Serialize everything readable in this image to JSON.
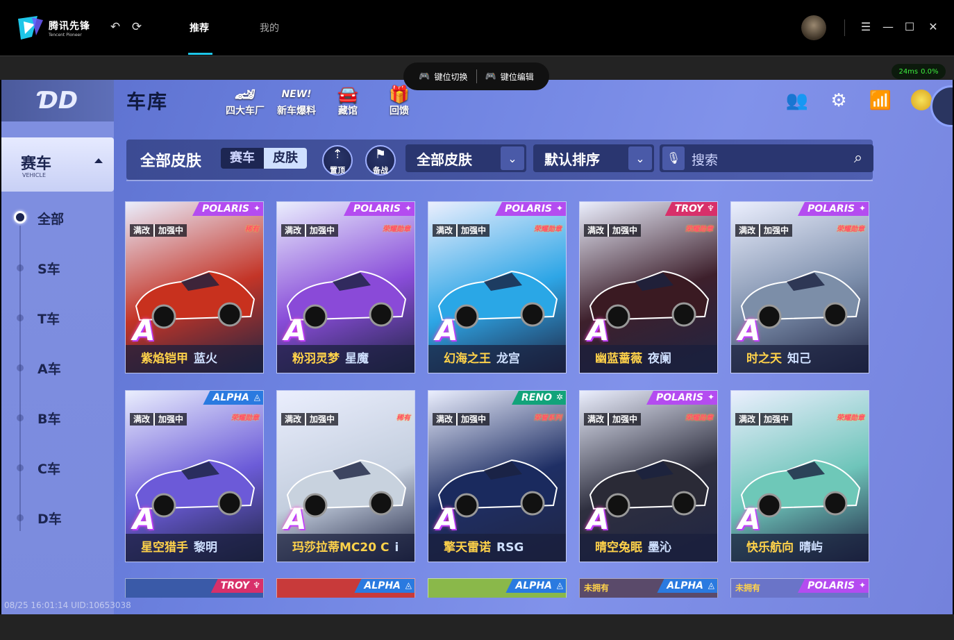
{
  "app": {
    "name": "腾讯先锋",
    "name_en": "Tencent Pioneer"
  },
  "nav": {
    "tabs": [
      {
        "label": "推荐"
      },
      {
        "label": "我的"
      }
    ]
  },
  "keybar": {
    "switch_label": "键位切换",
    "edit_label": "键位编辑"
  },
  "status": {
    "ping": "24ms",
    "loss": "0.0%"
  },
  "game": {
    "page_title": "车库",
    "header_tools": [
      {
        "label": "四大车厂",
        "icon": "car-factory-icon"
      },
      {
        "label": "新车爆料",
        "icon": "new-badge-icon"
      },
      {
        "label": "藏馆",
        "icon": "garage-icon"
      },
      {
        "label": "回馈",
        "icon": "gift-icon"
      }
    ],
    "sidebar": {
      "category": "赛车",
      "category_en": "VEHICLE",
      "items": [
        {
          "label": "全部",
          "active": true
        },
        {
          "label": "S车"
        },
        {
          "label": "T车"
        },
        {
          "label": "A车"
        },
        {
          "label": "B车"
        },
        {
          "label": "C车"
        },
        {
          "label": "D车"
        }
      ]
    },
    "filter": {
      "title": "全部皮肤",
      "segments": [
        {
          "label": "赛车"
        },
        {
          "label": "皮肤",
          "active": true
        }
      ],
      "pin_label": "置顶",
      "ready_label": "备战",
      "skin_dropdown": "全部皮肤",
      "sort_dropdown": "默认排序",
      "search_placeholder": "搜索"
    },
    "cards": [
      {
        "brand": "POLARIS",
        "maxed": "满改",
        "boost": "加强中",
        "badge": "稀有",
        "grade": "A",
        "name1": "紫焰铠甲",
        "name2": "蓝火",
        "color": "#c8311e"
      },
      {
        "brand": "POLARIS",
        "maxed": "满改",
        "boost": "加强中",
        "badge": "荣耀勋章",
        "grade": "A",
        "name1": "粉羽灵梦",
        "name2": "星魔",
        "color": "#8a4ad8"
      },
      {
        "brand": "POLARIS",
        "maxed": "满改",
        "boost": "加强中",
        "badge": "荣耀勋章",
        "grade": "A",
        "name1": "幻海之王",
        "name2": "龙宫",
        "color": "#2aa7e6"
      },
      {
        "brand": "TROY",
        "maxed": "满改",
        "boost": "加强中",
        "badge": "荣耀勋章",
        "grade": "A",
        "name1": "幽蓝蔷薇",
        "name2": "夜阑",
        "color": "#3a1a22"
      },
      {
        "brand": "POLARIS",
        "maxed": "满改",
        "boost": "加强中",
        "badge": "荣耀勋章",
        "grade": "A",
        "name1": "时之天",
        "name2": "知己",
        "color": "#7c8ea8"
      },
      {
        "brand": "ALPHA",
        "maxed": "满改",
        "boost": "加强中",
        "badge": "荣耀勋章",
        "grade": "A",
        "name1": "星空猎手",
        "name2": "黎明",
        "color": "#6c5ad8"
      },
      {
        "brand": "",
        "maxed": "满改",
        "boost": "加强中",
        "badge": "稀有",
        "grade": "A",
        "name1": "玛莎拉蒂MC20 C",
        "name2": "i",
        "color": "#c8d2de"
      },
      {
        "brand": "RENO",
        "maxed": "满改",
        "boost": "加强中",
        "badge": "荣誉系列",
        "grade": "A",
        "name1": "擎天雷诺",
        "name2": "RSG",
        "color": "#1a2a5e"
      },
      {
        "brand": "POLARIS",
        "maxed": "满改",
        "boost": "加强中",
        "badge": "荣耀勋章",
        "grade": "A",
        "name1": "晴空兔眠",
        "name2": "墨沁",
        "color": "#2a2a36"
      },
      {
        "brand": "",
        "maxed": "满改",
        "boost": "加强中",
        "badge": "荣耀勋章",
        "grade": "A",
        "name1": "快乐航向",
        "name2": "晴屿",
        "color": "#6ec8b8"
      }
    ],
    "partial_cards": [
      {
        "brand": "TROY",
        "unowned": ""
      },
      {
        "brand": "ALPHA",
        "unowned": ""
      },
      {
        "brand": "ALPHA",
        "unowned": ""
      },
      {
        "brand": "ALPHA",
        "unowned": "未拥有"
      },
      {
        "brand": "POLARIS",
        "unowned": "未拥有"
      }
    ],
    "stamp": "08/25 16:01:14 UID:10653038"
  },
  "colors": {
    "accent": "#1ec6e8",
    "brand_polaris": "#b44cf0",
    "brand_troy": "#d8306a",
    "brand_alpha": "#2a7ae0",
    "brand_reno": "#12a37a"
  }
}
